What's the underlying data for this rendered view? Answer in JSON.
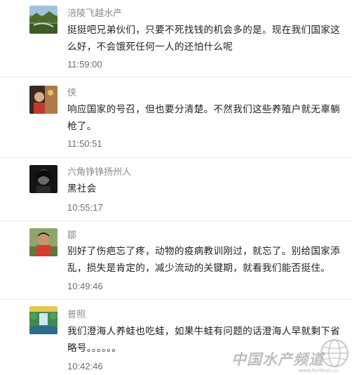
{
  "comments": [
    {
      "name": "涪陵飞越水产",
      "text": "挺挺吧兄弟伙们，只要不死找钱的机会多的是。现在我们国家这么好，不会饿死任何一人的还怕什么呢",
      "time": "11:59:00",
      "avatar_icon": "landscape-avatar-icon"
    },
    {
      "name": "侠",
      "text": "响应国家的号召，但也要分清楚。不然我们这些养殖户就无辜躺枪了。",
      "time": "11:50:51",
      "avatar_icon": "person-photo-avatar-icon"
    },
    {
      "name": "六角铮铮扬州人",
      "text": "黑社会",
      "time": "10:55:17",
      "avatar_icon": "dark-portrait-avatar-icon"
    },
    {
      "name": "鄒",
      "text": "别好了伤疤忘了疼，动物的疫病教训刚过，就忘了。别给国家添乱，损失是肯定的，减少流动的关键期，就看我们能否挺住。",
      "time": "10:49:46",
      "avatar_icon": "man-photo-avatar-icon"
    },
    {
      "name": "普照",
      "text": "我们澄海人养蛙也吃蛙，如果牛蛙有问题的话澄海人早就剩下省略号。。。。。。",
      "time": "10:42:46",
      "avatar_icon": "waterfall-avatar-icon"
    }
  ],
  "watermark": {
    "text": "中国水产频道",
    "url": "www.fishfirst.cn",
    "icon": "globe-icon"
  },
  "colors": {
    "name": "#8a8a8a",
    "text": "#222222",
    "time": "#6e6e6e",
    "divider": "#e9e9e9"
  }
}
